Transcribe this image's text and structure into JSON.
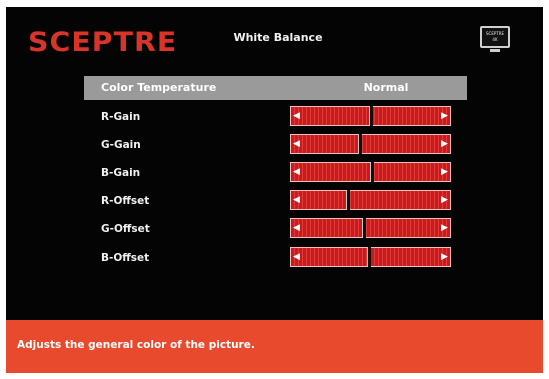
{
  "brand": "SCEPTRE",
  "title": "White Balance",
  "tv_icon": {
    "line1": "SCEPTRE",
    "line2": "4K"
  },
  "color_temperature": {
    "label": "Color Temperature",
    "value": "Normal"
  },
  "rows": [
    {
      "label": "R-Gain",
      "level": 0.5
    },
    {
      "label": "G-Gain",
      "level": 0.42
    },
    {
      "label": "B-Gain",
      "level": 0.51
    },
    {
      "label": "R-Offset",
      "level": 0.33
    },
    {
      "label": "G-Offset",
      "level": 0.45
    },
    {
      "label": "B-Offset",
      "level": 0.49
    }
  ],
  "footer": {
    "help": "Adjusts the general color of the picture."
  },
  "colors": {
    "accent": "#d9342a",
    "slider": "#c51d1d",
    "footer": "#e84a2e",
    "highlight": "#9a9a9a"
  }
}
